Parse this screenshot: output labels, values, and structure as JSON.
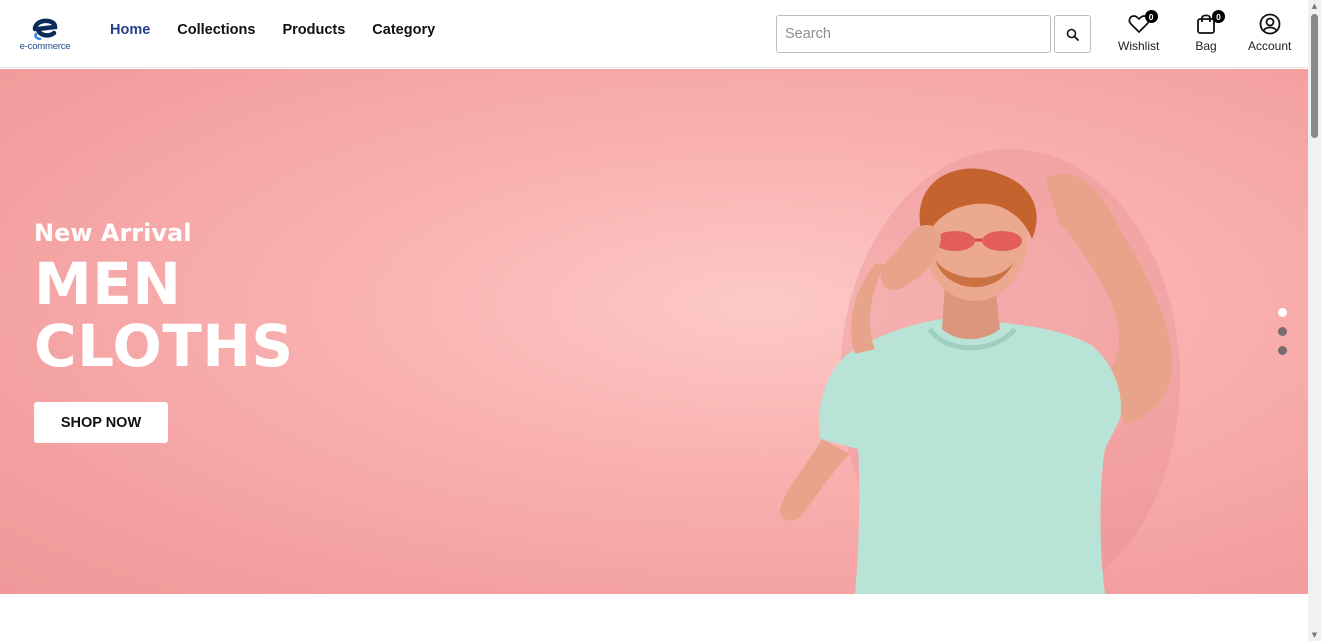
{
  "header": {
    "logo": {
      "text": "e-commerce",
      "icon": "e-logo-icon"
    },
    "nav": [
      {
        "label": "Home",
        "active": true
      },
      {
        "label": "Collections",
        "active": false
      },
      {
        "label": "Products",
        "active": false
      },
      {
        "label": "Category",
        "active": false
      }
    ],
    "search": {
      "placeholder": "Search",
      "value": "",
      "icon": "search-icon"
    },
    "actions": {
      "wishlist": {
        "label": "Wishlist",
        "count": "0",
        "icon": "heart-icon"
      },
      "bag": {
        "label": "Bag",
        "count": "0",
        "icon": "bag-icon"
      },
      "account": {
        "label": "Account",
        "icon": "user-circle-icon"
      }
    }
  },
  "hero": {
    "kicker": "New Arrival",
    "headline_line1": "MEN",
    "headline_line2": "CLOTHS",
    "button_label": "SHOP NOW",
    "slides": 3,
    "active_slide": 1
  },
  "colors": {
    "nav_active": "#27408b",
    "hero_background": "#f6a7a8",
    "button_background": "#ffffff"
  }
}
